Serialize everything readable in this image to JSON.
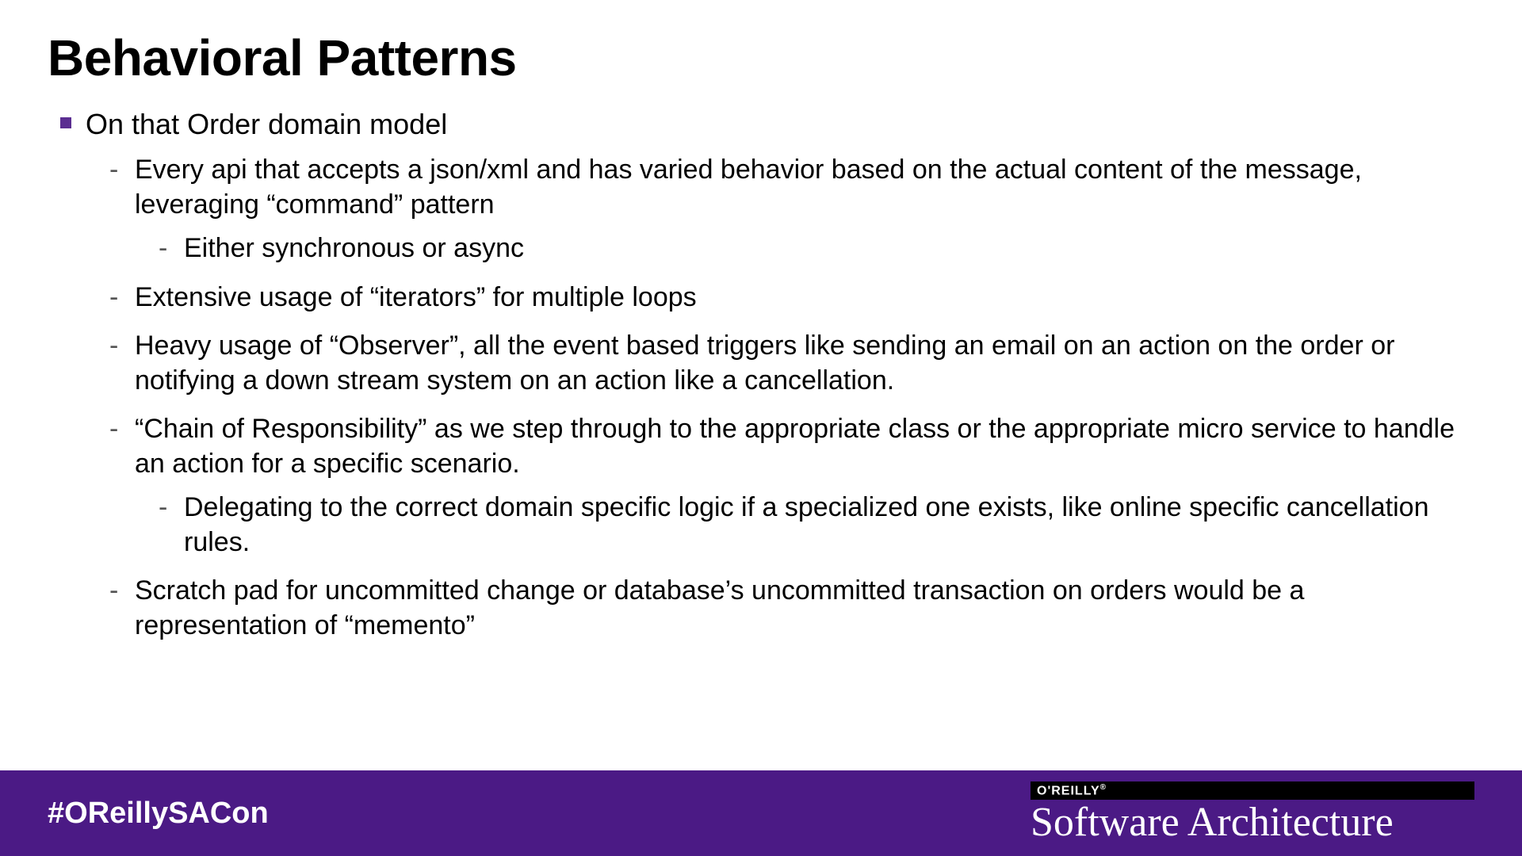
{
  "title": "Behavioral Patterns",
  "bullets": {
    "l1_0": "On that Order domain model",
    "l2_0": "Every api that accepts a json/xml and has varied behavior based on the actual content of the message, leveraging “command” pattern",
    "l3_0": "Either synchronous or async",
    "l2_1": "Extensive usage of “iterators” for multiple loops",
    "l2_2": "Heavy usage of “Observer”, all the event based triggers like sending an email on an action on the order or notifying a down stream system on an action like a cancellation.",
    "l2_3": "“Chain of Responsibility” as we step through to the appropriate class or the appropriate micro service to handle an action for a specific scenario.",
    "l3_1": "Delegating to the correct domain specific logic if a specialized one exists, like online specific cancellation rules.",
    "l2_4": "Scratch pad for uncommitted change or database’s uncommitted transaction on orders would be a representation of “memento”"
  },
  "footer": {
    "hashtag": "#OReillySACon",
    "brand_top": "O'REILLY",
    "brand_sup": "®",
    "brand_name": "Software Architecture"
  }
}
